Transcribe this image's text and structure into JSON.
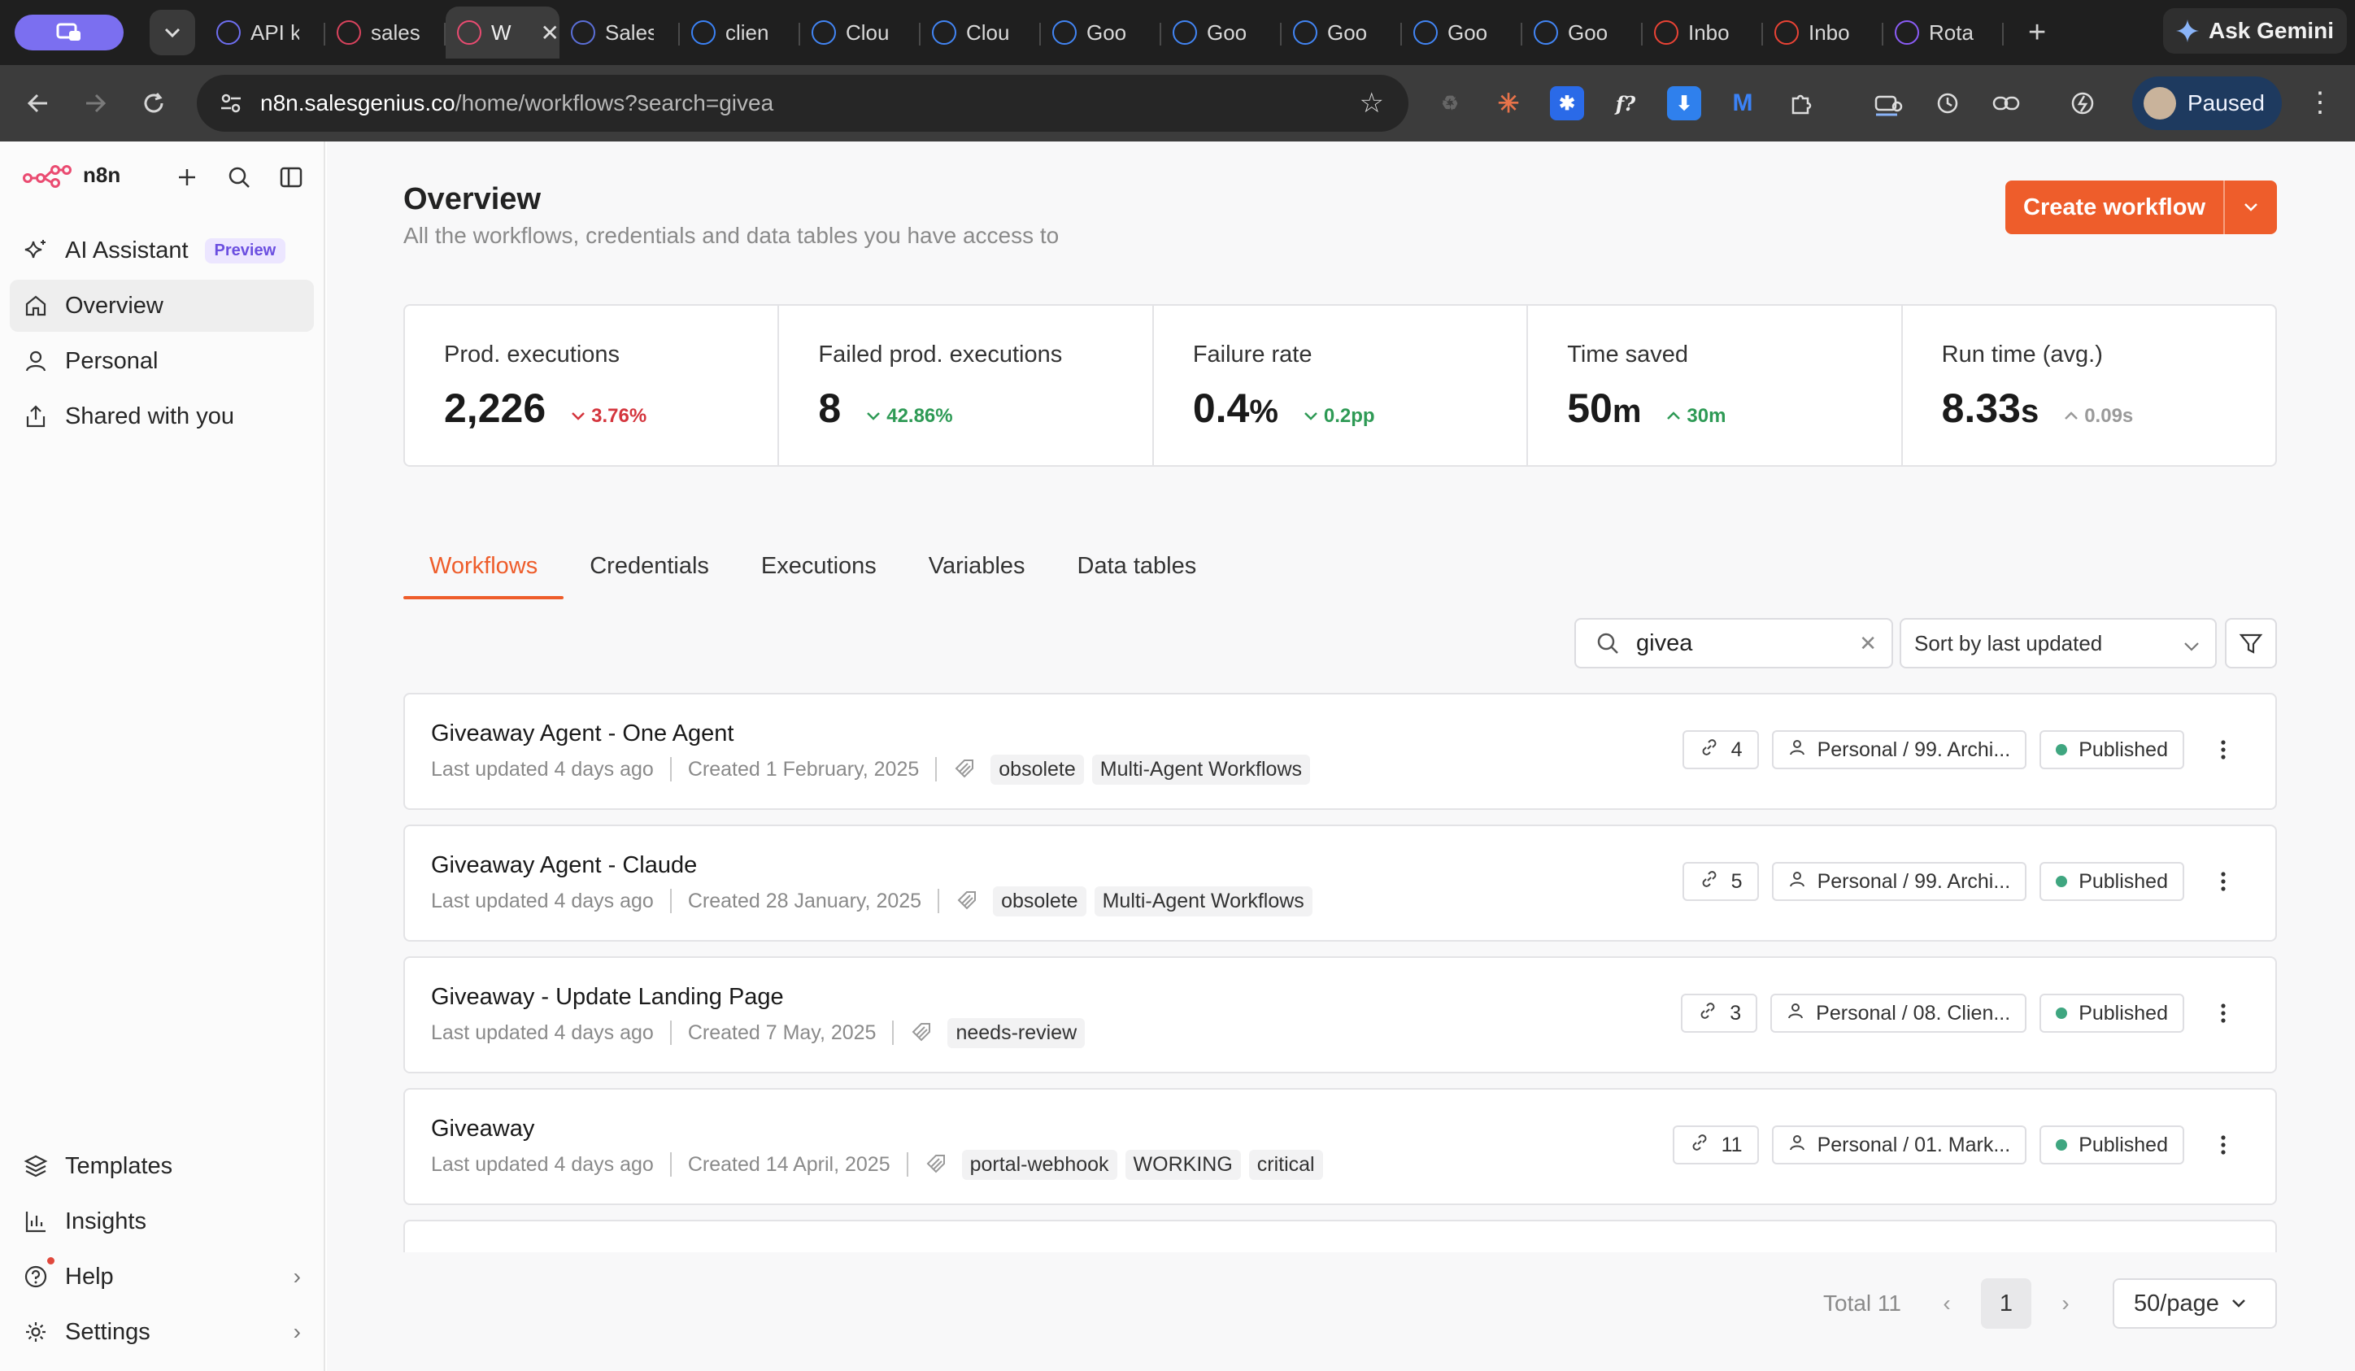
{
  "browser": {
    "tabs": [
      {
        "label": "API k",
        "icon": "app-s-icon",
        "color": "#6e6ef0"
      },
      {
        "label": "sales",
        "icon": "spark-icon",
        "color": "#d9435d"
      },
      {
        "label": "W",
        "icon": "n8n-icon",
        "color": "#ea4b71",
        "active": true,
        "close": "✕"
      },
      {
        "label": "Sales",
        "icon": "doc-icon",
        "color": "#5b6fd8"
      },
      {
        "label": "clien",
        "icon": "ring-icon",
        "color": "#3b82f6"
      },
      {
        "label": "Clou",
        "icon": "gcloud-icon",
        "color": "#4285f4"
      },
      {
        "label": "Clou",
        "icon": "gcloud-icon",
        "color": "#4285f4"
      },
      {
        "label": "Goo",
        "icon": "google-icon",
        "color": "#4285f4"
      },
      {
        "label": "Goo",
        "icon": "google-icon",
        "color": "#4285f4"
      },
      {
        "label": "Goo",
        "icon": "google-icon",
        "color": "#4285f4"
      },
      {
        "label": "Goo",
        "icon": "google-icon",
        "color": "#4285f4"
      },
      {
        "label": "Goo",
        "icon": "google-icon",
        "color": "#4285f4"
      },
      {
        "label": "Inbo",
        "icon": "gmail-icon",
        "color": "#ea4335"
      },
      {
        "label": "Inbo",
        "icon": "gmail-icon",
        "color": "#ea4335"
      },
      {
        "label": "Rota",
        "icon": "g-purple-icon",
        "color": "#8b5cf6"
      }
    ],
    "new_tab": "+",
    "gemini_label": "Ask Gemini",
    "url_host": "n8n.salesgenius.co",
    "url_path": "/home/workflows?search=givea",
    "profile_label": "Paused"
  },
  "sidebar": {
    "brand": "n8n",
    "items_top": [
      {
        "label": "AI Assistant",
        "badge": "Preview"
      },
      {
        "label": "Overview"
      },
      {
        "label": "Personal"
      },
      {
        "label": "Shared with you"
      }
    ],
    "items_bottom": [
      {
        "label": "Templates"
      },
      {
        "label": "Insights"
      },
      {
        "label": "Help"
      },
      {
        "label": "Settings"
      }
    ]
  },
  "header": {
    "title": "Overview",
    "subtitle": "All the workflows, credentials and data tables you have access to",
    "create_label": "Create workflow"
  },
  "stats": [
    {
      "label": "Prod. executions",
      "value": "2,226",
      "unit": "",
      "delta": "3.76%",
      "trend": "down",
      "status": "bad"
    },
    {
      "label": "Failed prod. executions",
      "value": "8",
      "unit": "",
      "delta": "42.86%",
      "trend": "down",
      "status": "good"
    },
    {
      "label": "Failure rate",
      "value": "0.4",
      "unit": "%",
      "delta": "0.2pp",
      "trend": "down",
      "status": "good"
    },
    {
      "label": "Time saved",
      "value": "50",
      "unit": "m",
      "delta": "30m",
      "trend": "up",
      "status": "good"
    },
    {
      "label": "Run time (avg.)",
      "value": "8.33",
      "unit": "s",
      "delta": "0.09s",
      "trend": "up",
      "status": "neutral"
    }
  ],
  "tabs": [
    "Workflows",
    "Credentials",
    "Executions",
    "Variables",
    "Data tables"
  ],
  "filters": {
    "search_value": "givea",
    "sort_label": "Sort by last updated"
  },
  "workflows": [
    {
      "name": "Giveaway Agent - One Agent",
      "updated": "Last updated 4 days ago",
      "created": "Created 1 February, 2025",
      "tags": [
        "obsolete",
        "Multi-Agent Workflows"
      ],
      "links": "4",
      "project": "Personal / 99. Archi...",
      "status": "Published"
    },
    {
      "name": "Giveaway Agent - Claude",
      "updated": "Last updated 4 days ago",
      "created": "Created 28 January, 2025",
      "tags": [
        "obsolete",
        "Multi-Agent Workflows"
      ],
      "links": "5",
      "project": "Personal / 99. Archi...",
      "status": "Published"
    },
    {
      "name": "Giveaway - Update Landing Page",
      "updated": "Last updated 4 days ago",
      "created": "Created 7 May, 2025",
      "tags": [
        "needs-review"
      ],
      "links": "3",
      "project": "Personal / 08. Clien...",
      "status": "Published"
    },
    {
      "name": "Giveaway",
      "updated": "Last updated 4 days ago",
      "created": "Created 14 April, 2025",
      "tags": [
        "portal-webhook",
        "WORKING",
        "critical"
      ],
      "links": "11",
      "project": "Personal / 01. Mark...",
      "status": "Published"
    }
  ],
  "pagination": {
    "total": "Total 11",
    "page": "1",
    "per_page": "50/page"
  },
  "colors": {
    "accent": "#ee5d2b",
    "published_dot": "#3fa680",
    "bad": "#d4353d",
    "good": "#2e9a55"
  }
}
